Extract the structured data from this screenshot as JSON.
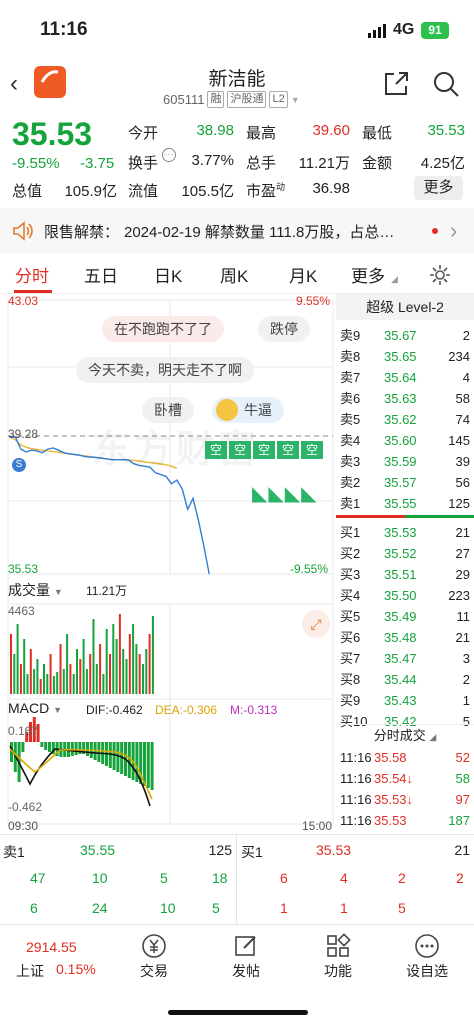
{
  "status": {
    "time": "11:16",
    "network": "4G",
    "battery": "91"
  },
  "header": {
    "name": "新洁能",
    "code": "605111",
    "tags": [
      "融",
      "沪股通",
      "L2"
    ]
  },
  "quote": {
    "price": "35.53",
    "change_pct": "-9.55%",
    "change": "-3.75",
    "open_label": "今开",
    "open": "38.98",
    "high_label": "最高",
    "high": "39.60",
    "low_label": "最低",
    "low": "35.53",
    "turnover_label": "换手",
    "turnover": "3.77%",
    "volume_label": "总手",
    "volume": "11.21万",
    "amount_label": "金额",
    "amount": "4.25亿",
    "mktcap_label": "总值",
    "mktcap": "105.9亿",
    "float_label": "流值",
    "float_cap": "105.5亿",
    "pe_label": "市盈",
    "pe_sup": "动",
    "pe": "36.98",
    "more": "更多"
  },
  "notice": {
    "label": "限售解禁：",
    "text": "2024-02-19 解禁数量 111.8万股，占总…"
  },
  "tabs": [
    "分时",
    "五日",
    "日K",
    "周K",
    "月K",
    "更多"
  ],
  "chart": {
    "ymax": "43.03",
    "ymax_pct": "9.55%",
    "ymin": "35.53",
    "ymin_pct": "-9.55%",
    "ref": "39.28",
    "bubbles": [
      "在不跑跑不了了",
      "跌停",
      "今天不卖，明天走不了啊",
      "卧槽",
      "牛逼"
    ],
    "watermark": "东方财富",
    "volume_label": "成交量",
    "volume_total": "11.21万",
    "volume_max": "4463",
    "macd_label": "MACD",
    "dif": "DIF:-0.462",
    "dea": "DEA:-0.306",
    "m": "M:-0.313",
    "macd_top": "0.167",
    "macd_bottom": "-0.462",
    "time_start": "09:30",
    "time_end": "15:00",
    "chart_data": {
      "type": "line",
      "ylim": [
        35.53,
        43.03
      ],
      "ref_price": 39.28,
      "price_path": [
        39.28,
        39.28,
        38.95,
        38.87,
        38.92,
        38.9,
        38.85,
        38.95,
        38.98,
        38.92,
        38.85,
        38.82,
        38.8,
        38.78,
        38.74,
        38.73,
        38.72,
        38.7,
        38.68,
        38.66,
        38.66,
        38.66,
        38.65,
        38.55,
        38.5,
        38.48,
        38.45,
        38.3,
        38.25,
        38.2,
        38.0,
        38.1,
        37.85,
        37.3,
        37.6,
        37.0,
        36.3,
        35.53
      ],
      "avg_path": [
        39.28,
        39.2,
        39.06,
        39.0,
        38.96,
        38.94,
        38.92,
        38.9,
        38.88,
        38.86,
        38.84,
        38.82,
        38.8,
        38.78,
        38.76,
        38.74,
        38.72,
        38.7,
        38.68,
        38.66,
        38.66,
        38.66,
        38.65,
        38.64,
        38.62,
        38.6,
        38.58,
        38.56,
        38.54,
        38.52,
        38.48,
        38.42
      ]
    }
  },
  "book": {
    "title": "超级 Level-2",
    "asks": [
      [
        "卖9",
        "35.67",
        "2"
      ],
      [
        "卖8",
        "35.65",
        "234"
      ],
      [
        "卖7",
        "35.64",
        "4"
      ],
      [
        "卖6",
        "35.63",
        "58"
      ],
      [
        "卖5",
        "35.62",
        "74"
      ],
      [
        "卖4",
        "35.60",
        "145"
      ],
      [
        "卖3",
        "35.59",
        "39"
      ],
      [
        "卖2",
        "35.57",
        "56"
      ],
      [
        "卖1",
        "35.55",
        "125"
      ]
    ],
    "bids": [
      [
        "买1",
        "35.53",
        "21"
      ],
      [
        "买2",
        "35.52",
        "27"
      ],
      [
        "买3",
        "35.51",
        "29"
      ],
      [
        "买4",
        "35.50",
        "223"
      ],
      [
        "买5",
        "35.49",
        "11"
      ],
      [
        "买6",
        "35.48",
        "21"
      ],
      [
        "买7",
        "35.47",
        "3"
      ],
      [
        "买8",
        "35.44",
        "2"
      ],
      [
        "买9",
        "35.43",
        "1"
      ],
      [
        "买10",
        "35.42",
        "5"
      ]
    ],
    "trades_title": "分时成交",
    "trades": [
      [
        "11:16",
        "35.58",
        "52"
      ],
      [
        "11:16",
        "35.54↓",
        "58"
      ],
      [
        "11:16",
        "35.53↓",
        "97"
      ],
      [
        "11:16",
        "35.53",
        "187"
      ]
    ]
  },
  "bottom": {
    "sell_label": "卖1",
    "sell_price": "35.55",
    "sell_qty": "125",
    "buy_label": "买1",
    "buy_price": "35.53",
    "buy_qty": "21",
    "sell_row1": [
      "47",
      "10",
      "5",
      "18"
    ],
    "sell_row2": [
      "6",
      "24",
      "10",
      "5"
    ],
    "buy_row1": [
      "6",
      "4",
      "2",
      "2"
    ],
    "buy_row2": [
      "1",
      "1",
      "5",
      ""
    ]
  },
  "nav": {
    "index_value": "2914.55",
    "index_name": "上证",
    "index_pct": "0.15%",
    "items": [
      "交易",
      "发帖",
      "功能",
      "设自选"
    ]
  }
}
